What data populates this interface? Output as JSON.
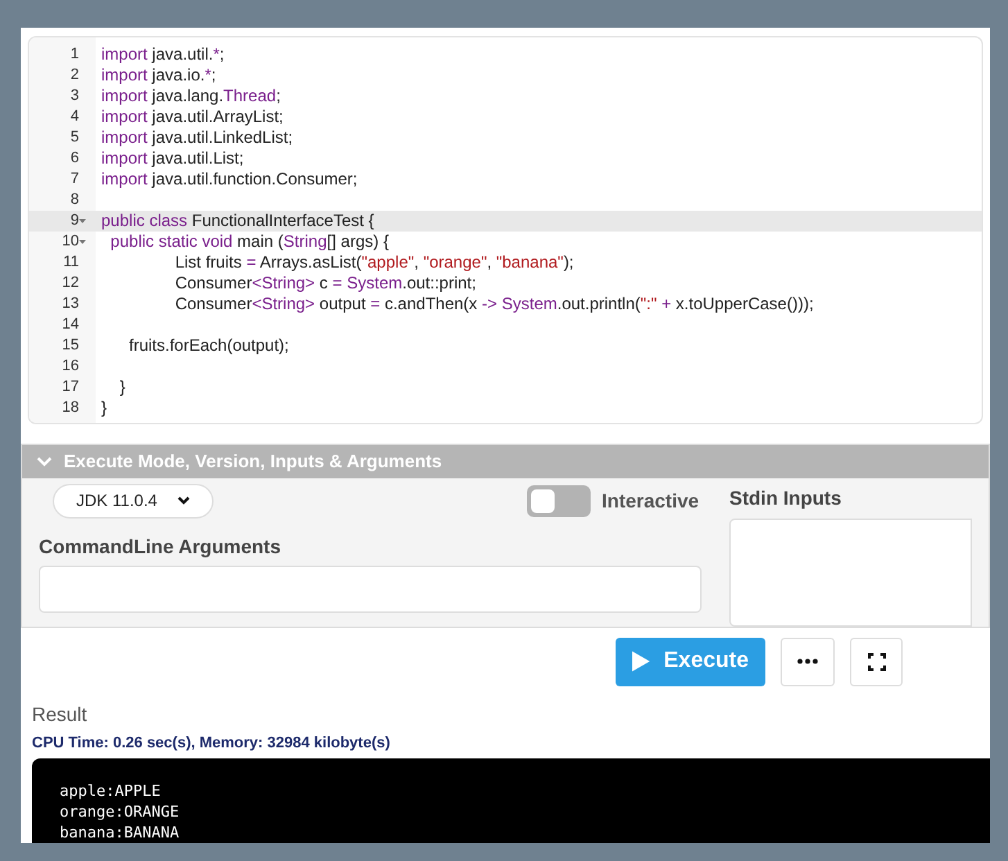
{
  "editor": {
    "lines": [
      {
        "number": "1",
        "fold": false,
        "active": false,
        "tokens": [
          {
            "kind": "kw",
            "text": "import"
          },
          {
            "kind": "plain",
            "text": " java.util."
          },
          {
            "kind": "kw",
            "text": "*"
          },
          {
            "kind": "plain",
            "text": ";"
          }
        ]
      },
      {
        "number": "2",
        "fold": false,
        "active": false,
        "tokens": [
          {
            "kind": "kw",
            "text": "import"
          },
          {
            "kind": "plain",
            "text": " java.io."
          },
          {
            "kind": "kw",
            "text": "*"
          },
          {
            "kind": "plain",
            "text": ";"
          }
        ]
      },
      {
        "number": "3",
        "fold": false,
        "active": false,
        "tokens": [
          {
            "kind": "kw",
            "text": "import"
          },
          {
            "kind": "plain",
            "text": " java.lang."
          },
          {
            "kind": "kw",
            "text": "Thread"
          },
          {
            "kind": "plain",
            "text": ";"
          }
        ]
      },
      {
        "number": "4",
        "fold": false,
        "active": false,
        "tokens": [
          {
            "kind": "kw",
            "text": "import"
          },
          {
            "kind": "plain",
            "text": " java.util.ArrayList;"
          }
        ]
      },
      {
        "number": "5",
        "fold": false,
        "active": false,
        "tokens": [
          {
            "kind": "kw",
            "text": "import"
          },
          {
            "kind": "plain",
            "text": " java.util.LinkedList;"
          }
        ]
      },
      {
        "number": "6",
        "fold": false,
        "active": false,
        "tokens": [
          {
            "kind": "kw",
            "text": "import"
          },
          {
            "kind": "plain",
            "text": " java.util.List;"
          }
        ]
      },
      {
        "number": "7",
        "fold": false,
        "active": false,
        "tokens": [
          {
            "kind": "kw",
            "text": "import"
          },
          {
            "kind": "plain",
            "text": " java.util.function.Consumer;"
          }
        ]
      },
      {
        "number": "8",
        "fold": false,
        "active": false
      },
      {
        "number": "9",
        "fold": true,
        "active": true,
        "tokens": [
          {
            "kind": "kw",
            "text": "public"
          },
          {
            "kind": "kw",
            "text": " class"
          },
          {
            "kind": "plain",
            "text": " FunctionalInterfaceTest {"
          }
        ]
      },
      {
        "number": "10",
        "fold": true,
        "active": false,
        "tokens": [
          {
            "kind": "kw",
            "text": "  public static void"
          },
          {
            "kind": "plain",
            "text": " main ("
          },
          {
            "kind": "kw",
            "text": "String"
          },
          {
            "kind": "plain",
            "text": "[] args) {"
          }
        ]
      },
      {
        "number": "11",
        "fold": false,
        "active": false,
        "tokens": [
          {
            "kind": "plain",
            "text": "                List fruits "
          },
          {
            "kind": "kw",
            "text": "="
          },
          {
            "kind": "plain",
            "text": " Arrays.asList("
          },
          {
            "kind": "str",
            "text": "\"apple\""
          },
          {
            "kind": "plain",
            "text": ", "
          },
          {
            "kind": "str",
            "text": "\"orange\""
          },
          {
            "kind": "plain",
            "text": ", "
          },
          {
            "kind": "str",
            "text": "\"banana\""
          },
          {
            "kind": "plain",
            "text": ");"
          }
        ]
      },
      {
        "number": "12",
        "fold": false,
        "active": false,
        "tokens": [
          {
            "kind": "plain",
            "text": "                Consumer"
          },
          {
            "kind": "kw",
            "text": "<String>"
          },
          {
            "kind": "plain",
            "text": " c "
          },
          {
            "kind": "kw",
            "text": "="
          },
          {
            "kind": "kw",
            "text": " System"
          },
          {
            "kind": "plain",
            "text": ".out::print;"
          }
        ]
      },
      {
        "number": "13",
        "fold": false,
        "active": false,
        "tokens": [
          {
            "kind": "plain",
            "text": "                Consumer"
          },
          {
            "kind": "kw",
            "text": "<String>"
          },
          {
            "kind": "plain",
            "text": " output "
          },
          {
            "kind": "kw",
            "text": "="
          },
          {
            "kind": "plain",
            "text": " c.andThen(x "
          },
          {
            "kind": "kw",
            "text": "->"
          },
          {
            "kind": "kw",
            "text": " System"
          },
          {
            "kind": "plain",
            "text": ".out.println("
          },
          {
            "kind": "str",
            "text": "\":\""
          },
          {
            "kind": "kw",
            "text": " +"
          },
          {
            "kind": "plain",
            "text": " x.toUpperCase()));"
          }
        ]
      },
      {
        "number": "14",
        "fold": false,
        "active": false
      },
      {
        "number": "15",
        "fold": false,
        "active": false,
        "tokens": [
          {
            "kind": "plain",
            "text": "      fruits.forEach(output);"
          }
        ]
      },
      {
        "number": "16",
        "fold": false,
        "active": false
      },
      {
        "number": "17",
        "fold": false,
        "active": false,
        "tokens": [
          {
            "kind": "plain",
            "text": "    }"
          }
        ]
      },
      {
        "number": "18",
        "fold": false,
        "active": false,
        "tokens": [
          {
            "kind": "plain",
            "text": "}"
          }
        ]
      }
    ]
  },
  "options": {
    "title": "Execute Mode, Version, Inputs & Arguments",
    "expanded": true,
    "version": "JDK 11.0.4",
    "interactive": {
      "label": "Interactive",
      "on": false
    },
    "stdin_label": "Stdin Inputs",
    "args_label": "CommandLine Arguments"
  },
  "execute_button": "Execute",
  "result": {
    "title": "Result",
    "stats": "CPU Time: 0.26 sec(s), Memory: 32984 kilobyte(s)",
    "output": [
      "apple:APPLE",
      "orange:ORANGE",
      "banana:BANANA"
    ]
  }
}
